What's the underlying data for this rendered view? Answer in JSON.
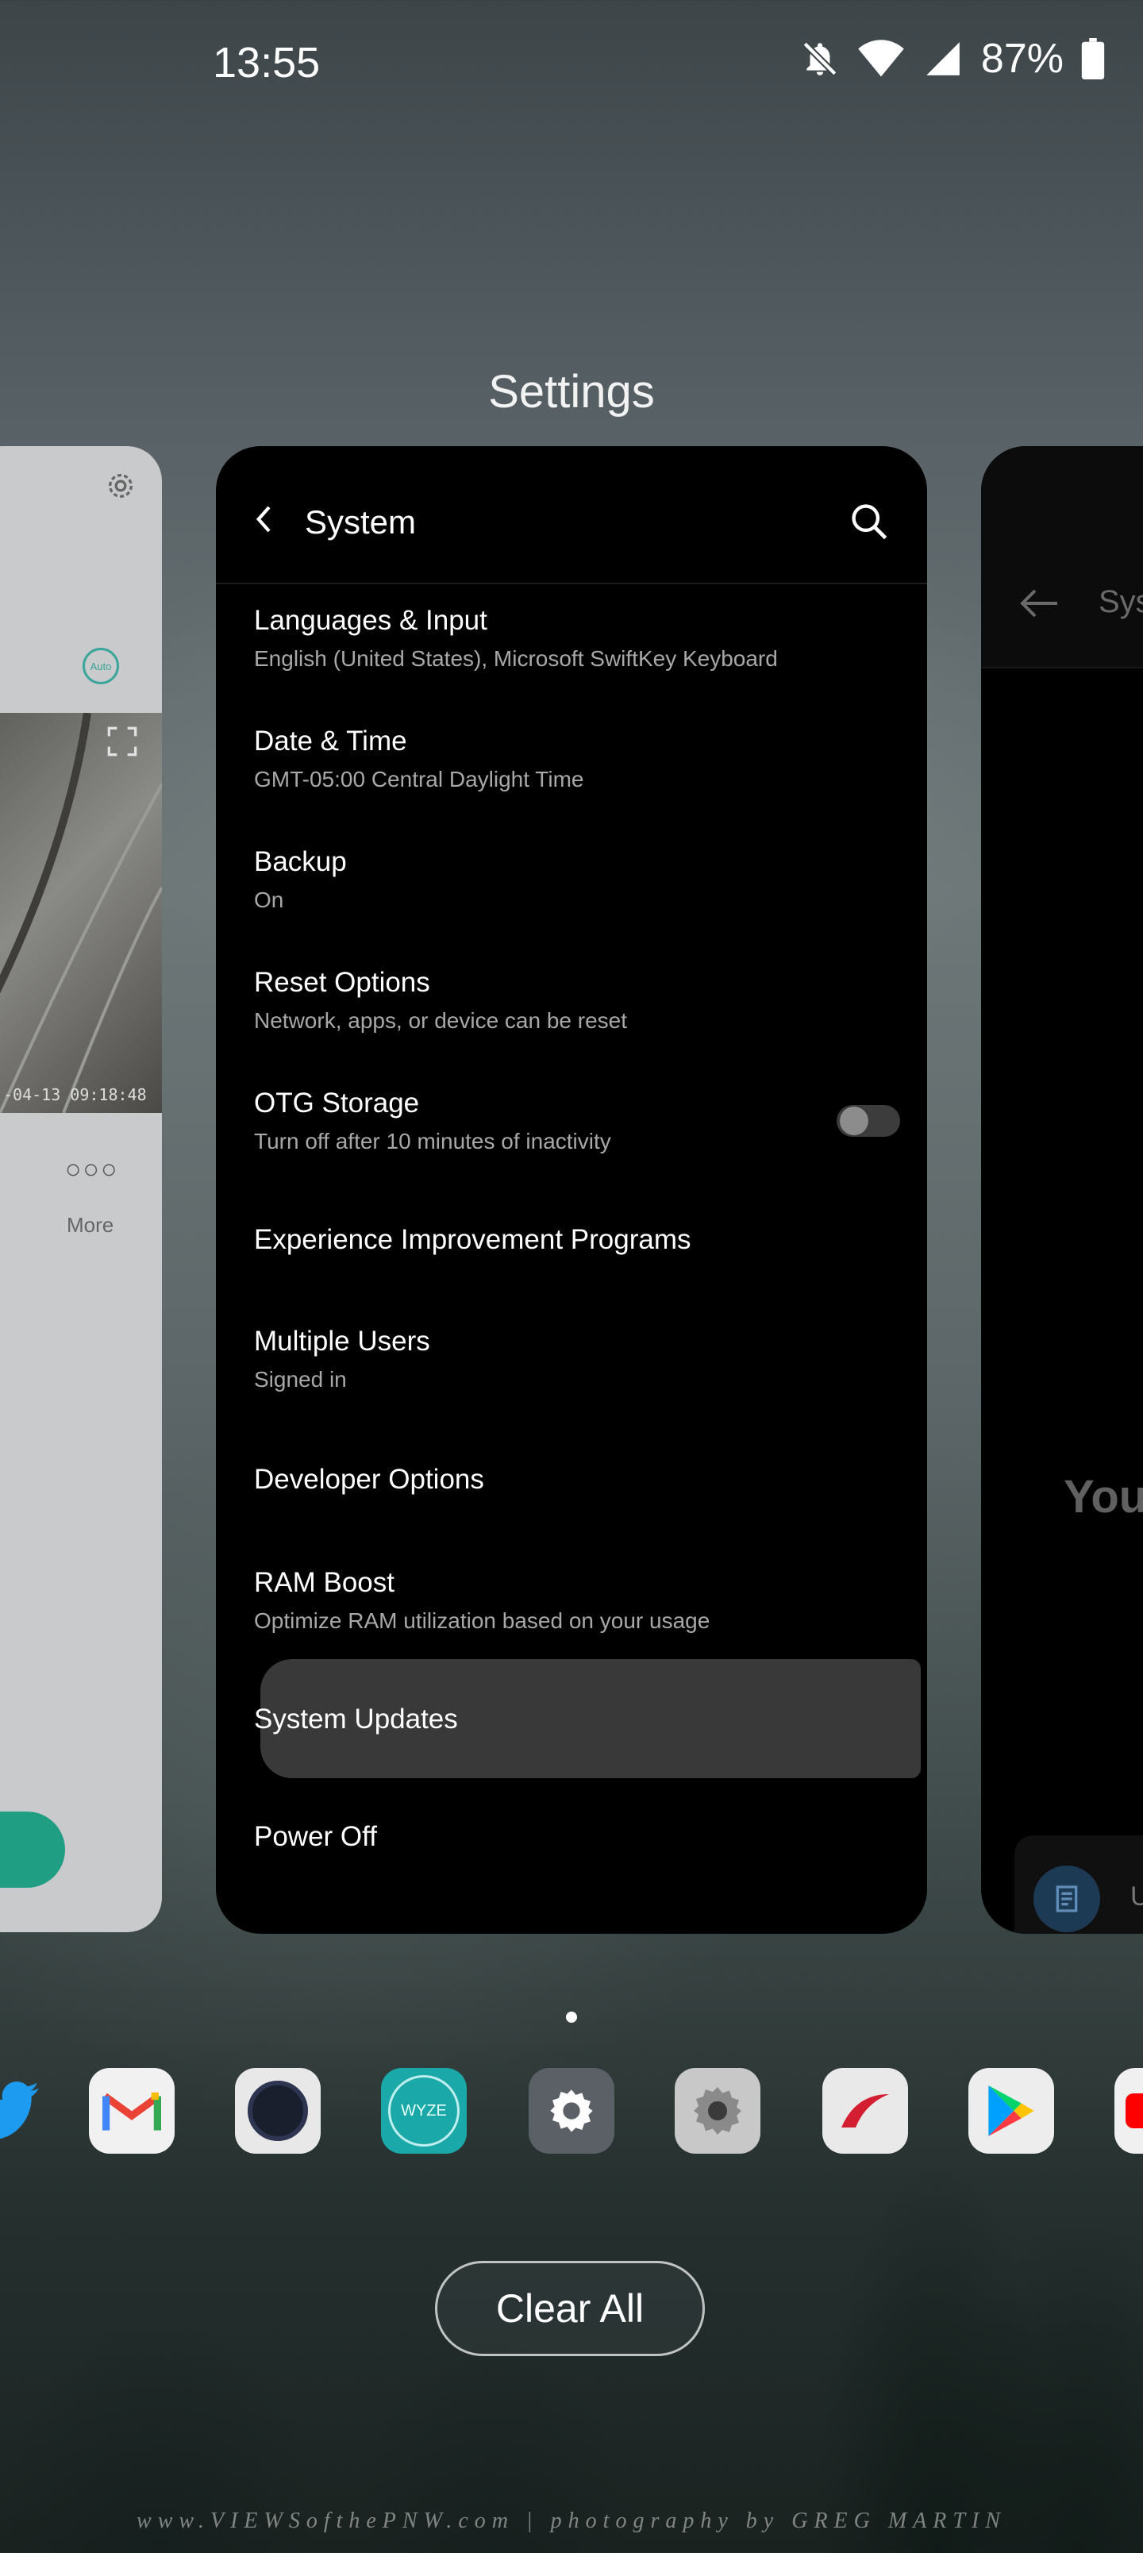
{
  "status_bar": {
    "time": "13:55",
    "battery": "87%",
    "icons": [
      "mute-icon",
      "wifi-icon",
      "signal-icon",
      "battery-icon"
    ]
  },
  "recents": {
    "current_app_title": "Settings",
    "left_card": {
      "timestamp": "-04-13 09:18:48",
      "more_label": "More",
      "icons": [
        "gear-icon",
        "auto-icon",
        "expand-icon",
        "more-dots-icon"
      ]
    },
    "main_card": {
      "header_title": "System",
      "items": [
        {
          "title": "Languages & Input",
          "subtitle": "English (United States), Microsoft SwiftKey Keyboard"
        },
        {
          "title": "Date & Time",
          "subtitle": "GMT-05:00 Central Daylight Time"
        },
        {
          "title": "Backup",
          "subtitle": "On"
        },
        {
          "title": "Reset Options",
          "subtitle": "Network, apps, or device can be reset"
        },
        {
          "title": "OTG Storage",
          "subtitle": "Turn off after 10 minutes of inactivity"
        },
        {
          "title": "Experience Improvement Programs",
          "subtitle": ""
        },
        {
          "title": "Multiple Users",
          "subtitle": "Signed in"
        },
        {
          "title": "Developer Options",
          "subtitle": ""
        },
        {
          "title": "RAM Boost",
          "subtitle": "Optimize RAM utilization based on your usage"
        },
        {
          "title": "System Updates",
          "subtitle": ""
        },
        {
          "title": "Power Off",
          "subtitle": ""
        }
      ],
      "otg_toggle_on": false
    },
    "right_card": {
      "header_title": "Sys",
      "big_text": "You",
      "bottom_letter": "U"
    }
  },
  "dock": {
    "apps": [
      "twitter",
      "gmail",
      "camera",
      "wyze",
      "settings",
      "settings-alt",
      "app-red-swoosh",
      "play-store",
      "app-red"
    ],
    "wyze_label": "WYZE"
  },
  "clear_all_label": "Clear All",
  "watermark": "www.VIEWSofthePNW.com  |  photography by GREG MARTIN",
  "colors": {
    "card_bg": "#000000",
    "highlight": "#393939",
    "wyze": "#1aa8a8",
    "settings_icon_bg": "#5b6066"
  }
}
